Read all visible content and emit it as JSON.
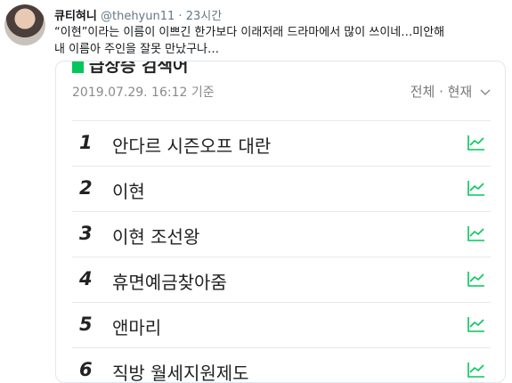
{
  "tweet": {
    "user_name": "큐티혀니",
    "handle": "@thehyun11",
    "separator": "·",
    "time": "23시간",
    "text_line1": "“이현”이라는 이름이 이쁘긴 한가보다 이래저래 드라마에서 많이 쓰이네…미안해",
    "text_line2": "내 이름아 주인을 잘못 만났구나…"
  },
  "panel": {
    "title": "급상승 검색어",
    "timestamp": "2019.07.29. 16:12 기준",
    "filter_label": "전체 · 현재",
    "filter_icon": "chevron-down-icon",
    "accent_color": "#03c75a",
    "items": [
      {
        "rank": "1",
        "keyword": "안다르 시즌오프 대란",
        "icon": "trend-chart-icon"
      },
      {
        "rank": "2",
        "keyword": "이현",
        "icon": "trend-chart-icon"
      },
      {
        "rank": "3",
        "keyword": "이현 조선왕",
        "icon": "trend-chart-icon"
      },
      {
        "rank": "4",
        "keyword": "휴면예금찾아줌",
        "icon": "trend-chart-icon"
      },
      {
        "rank": "5",
        "keyword": "앤마리",
        "icon": "trend-chart-icon"
      },
      {
        "rank": "6",
        "keyword": "직방 월세지원제도",
        "icon": "trend-chart-icon"
      }
    ]
  }
}
